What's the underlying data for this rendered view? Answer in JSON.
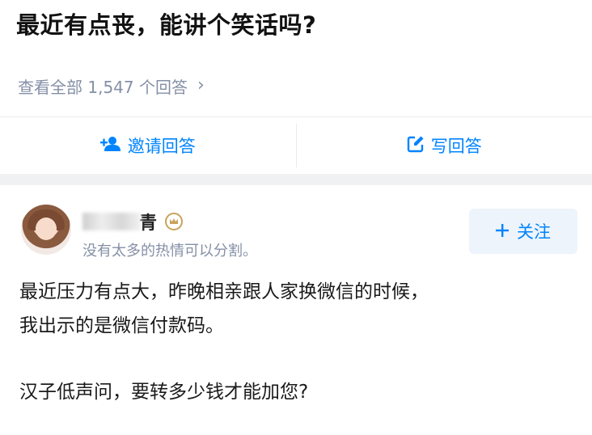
{
  "question": {
    "title": "最近有点丧，能讲个笑话吗?",
    "view_all": "查看全部 1,547 个回答"
  },
  "actions": {
    "invite_label": "邀请回答",
    "write_label": "写回答"
  },
  "author": {
    "name_visible": "青",
    "bio": "没有太多的热情可以分割。"
  },
  "follow": {
    "label": "关注"
  },
  "answer": {
    "paragraph1_line1": "最近压力有点大，昨晚相亲跟人家换微信的时候，",
    "paragraph1_line2": "我出示的是微信付款码。",
    "paragraph2": "汉子低声问，要转多少钱才能加您?"
  },
  "colors": {
    "accent": "#0084ff",
    "muted": "#8590a6",
    "band": "#f0f1f3",
    "badge": "#c8a35b"
  },
  "icons": {
    "invite": "add-user-icon",
    "write": "edit-icon",
    "more": "chevron-right-icon",
    "follow": "plus-icon",
    "badge": "crown-badge-icon"
  }
}
